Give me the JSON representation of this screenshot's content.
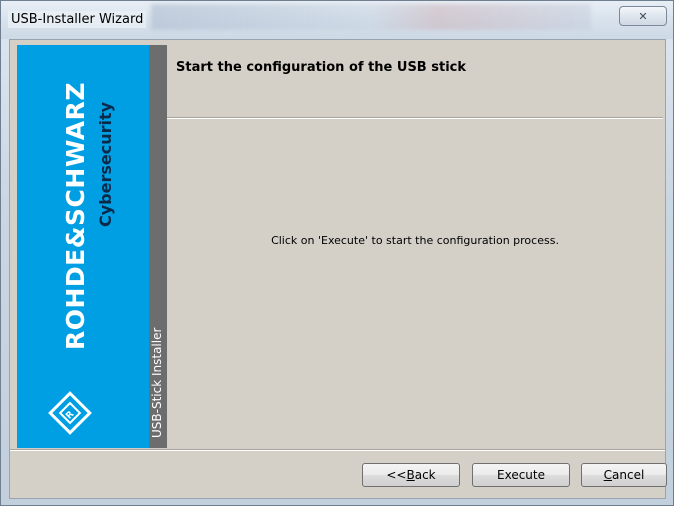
{
  "window": {
    "title": "USB-Installer Wizard",
    "close_glyph": "✕"
  },
  "brand": {
    "name": "ROHDE&SCHWARZ",
    "subtitle": "Cybersecurity",
    "logo_icon": "rohde-schwarz-diamond-logo",
    "color": "#009fe3"
  },
  "side_strip": {
    "label": "USB-Stick Installer",
    "color": "#6d6d6d"
  },
  "header": {
    "title": "Start the configuration of the USB stick"
  },
  "body": {
    "message": "Click on 'Execute' to start the configuration process."
  },
  "buttons": {
    "back": {
      "prefix": "<< ",
      "mnemonic": "B",
      "rest": "ack"
    },
    "execute": {
      "label": "Execute"
    },
    "cancel": {
      "mnemonic": "C",
      "rest": "ancel"
    }
  }
}
